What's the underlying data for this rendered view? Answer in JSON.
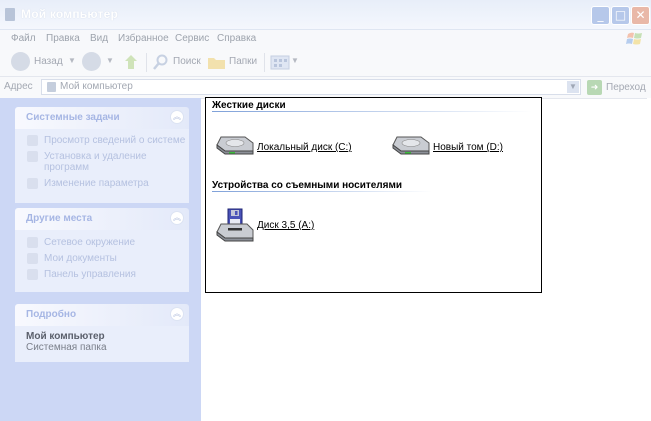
{
  "window": {
    "title": "Мой компьютер"
  },
  "menu": [
    "Файл",
    "Правка",
    "Вид",
    "Избранное",
    "Сервис",
    "Справка"
  ],
  "toolbar": {
    "back": "Назад",
    "search": "Поиск",
    "folders": "Папки"
  },
  "address": {
    "label": "Адрес",
    "value": "Мой компьютер",
    "go": "Переход"
  },
  "sidebar": {
    "system_tasks": {
      "title": "Системные задачи",
      "items": [
        "Просмотр сведений о системе",
        "Установка и удаление программ",
        "Изменение параметра"
      ]
    },
    "other_places": {
      "title": "Другие места",
      "items": [
        "Сетевое окружение",
        "Мои документы",
        "Панель управления"
      ]
    },
    "details": {
      "title": "Подробно",
      "name": "Мой компьютер",
      "type": "Системная папка"
    }
  },
  "content": {
    "hard_drives": {
      "title": "Жесткие диски",
      "items": [
        "Локальный диск (C:)",
        "Новый том (D:)"
      ]
    },
    "removable": {
      "title": "Устройства со съемными носителями",
      "items": [
        "Диск 3,5 (A:)"
      ]
    }
  },
  "colors": {
    "sidebar_bg": "#ccd7f5",
    "title_bar": "#e8eef9",
    "group_line": "#7fa1d9"
  },
  "icons": {
    "hard_drive": "hard-drive-icon",
    "floppy": "floppy-disk-icon"
  }
}
